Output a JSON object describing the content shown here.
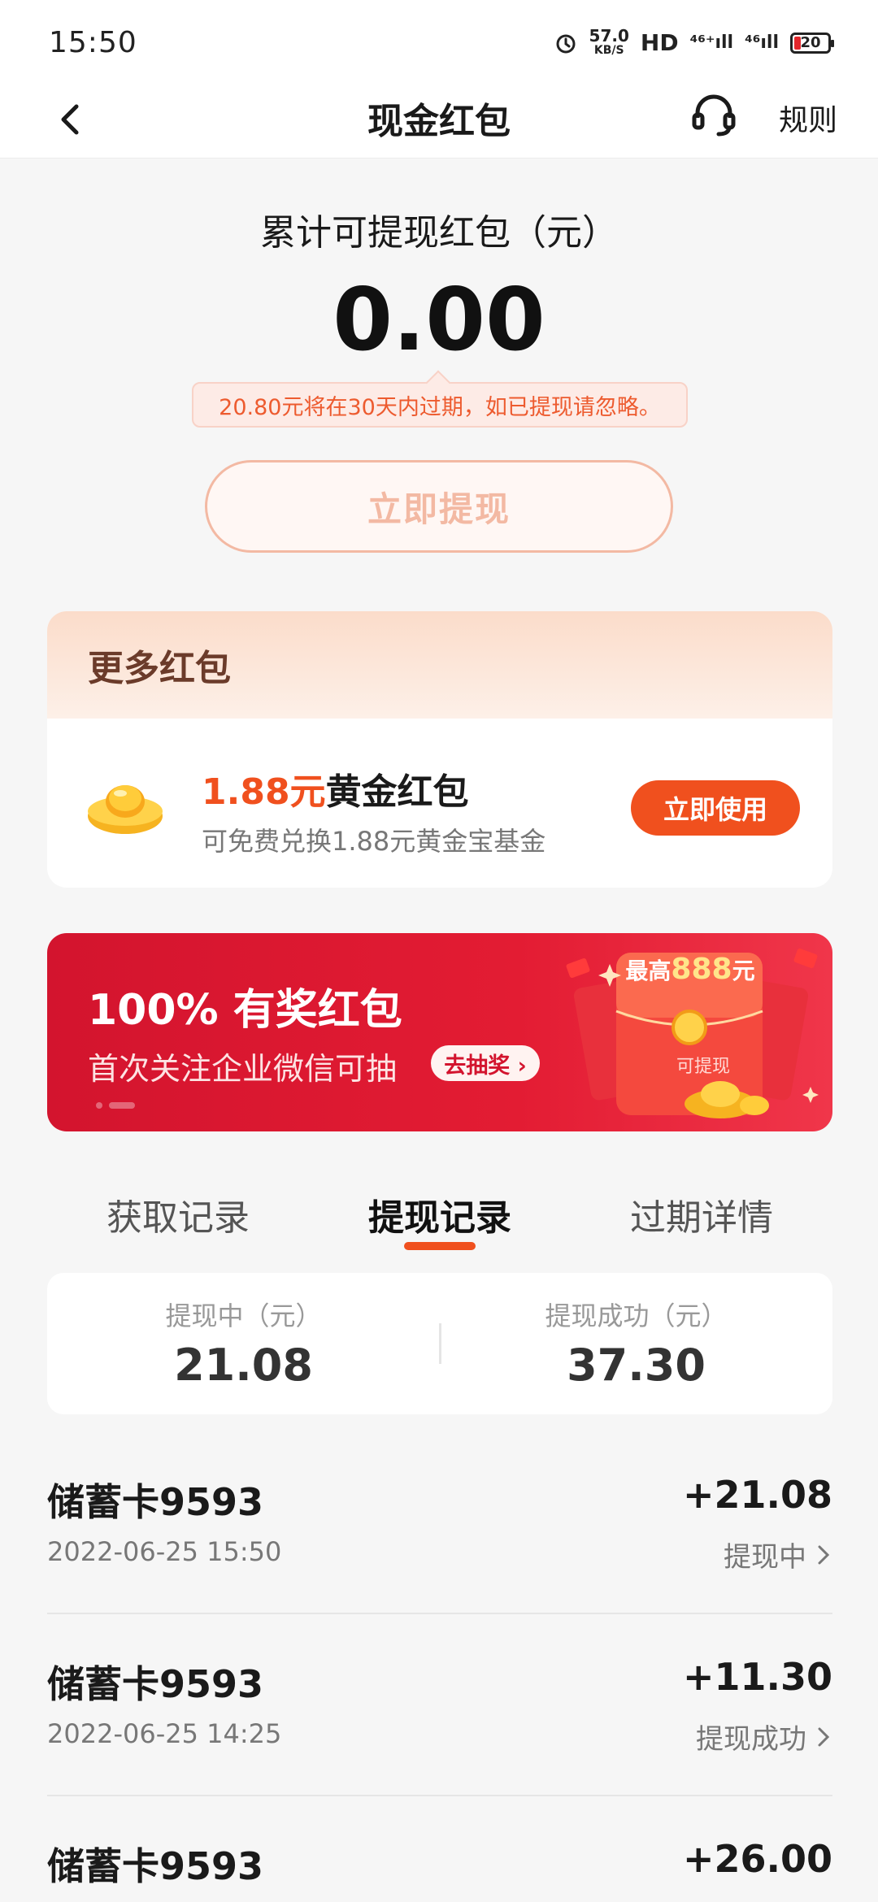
{
  "status_bar": {
    "time": "15:50",
    "speed_value": "57.0",
    "speed_unit": "KB/S",
    "hd": "HD",
    "signal1": "⁴⁶⁺ıll",
    "signal2": "⁴⁶ıll",
    "battery": "20",
    "icons": [
      "alarm-icon",
      "battery-icon"
    ]
  },
  "nav": {
    "title": "现金红包",
    "rules": "规则",
    "icons": [
      "back-arrow-icon",
      "headset-icon"
    ]
  },
  "balance": {
    "label": "累计可提现红包（元）",
    "amount": "0.00",
    "expire_tip": "20.80元将在30天内过期，如已提现请忽略。",
    "withdraw_button": "立即提现"
  },
  "more": {
    "title": "更多红包",
    "item_amount": "1.88元",
    "item_name": "黄金红包",
    "item_desc": "可免费兑换1.88元黄金宝基金",
    "use_button": "立即使用",
    "icon": "gold-ingot-icon"
  },
  "banner": {
    "title": "100% 有奖红包",
    "subtitle": "首次关注企业微信可抽",
    "pill": "去抽奖 ›",
    "envelope_prefix": "最高",
    "envelope_amount": "888",
    "envelope_suffix": "元",
    "envelope_label": "可提现"
  },
  "tabs": [
    {
      "label": "获取记录",
      "active": false
    },
    {
      "label": "提现记录",
      "active": true
    },
    {
      "label": "过期详情",
      "active": false
    }
  ],
  "summary": {
    "pending_label": "提现中（元）",
    "pending_value": "21.08",
    "success_label": "提现成功（元）",
    "success_value": "37.30"
  },
  "records": [
    {
      "name": "储蓄卡9593",
      "time": "2022-06-25 15:50",
      "amount": "+21.08",
      "status": "提现中"
    },
    {
      "name": "储蓄卡9593",
      "time": "2022-06-25 14:25",
      "amount": "+11.30",
      "status": "提现成功"
    },
    {
      "name": "储蓄卡9593",
      "time": "",
      "amount": "+26.00",
      "status": ""
    }
  ],
  "colors": {
    "accent": "#f0501e",
    "banner_red": "#d3142e",
    "tip_bg": "#fdebe6"
  }
}
